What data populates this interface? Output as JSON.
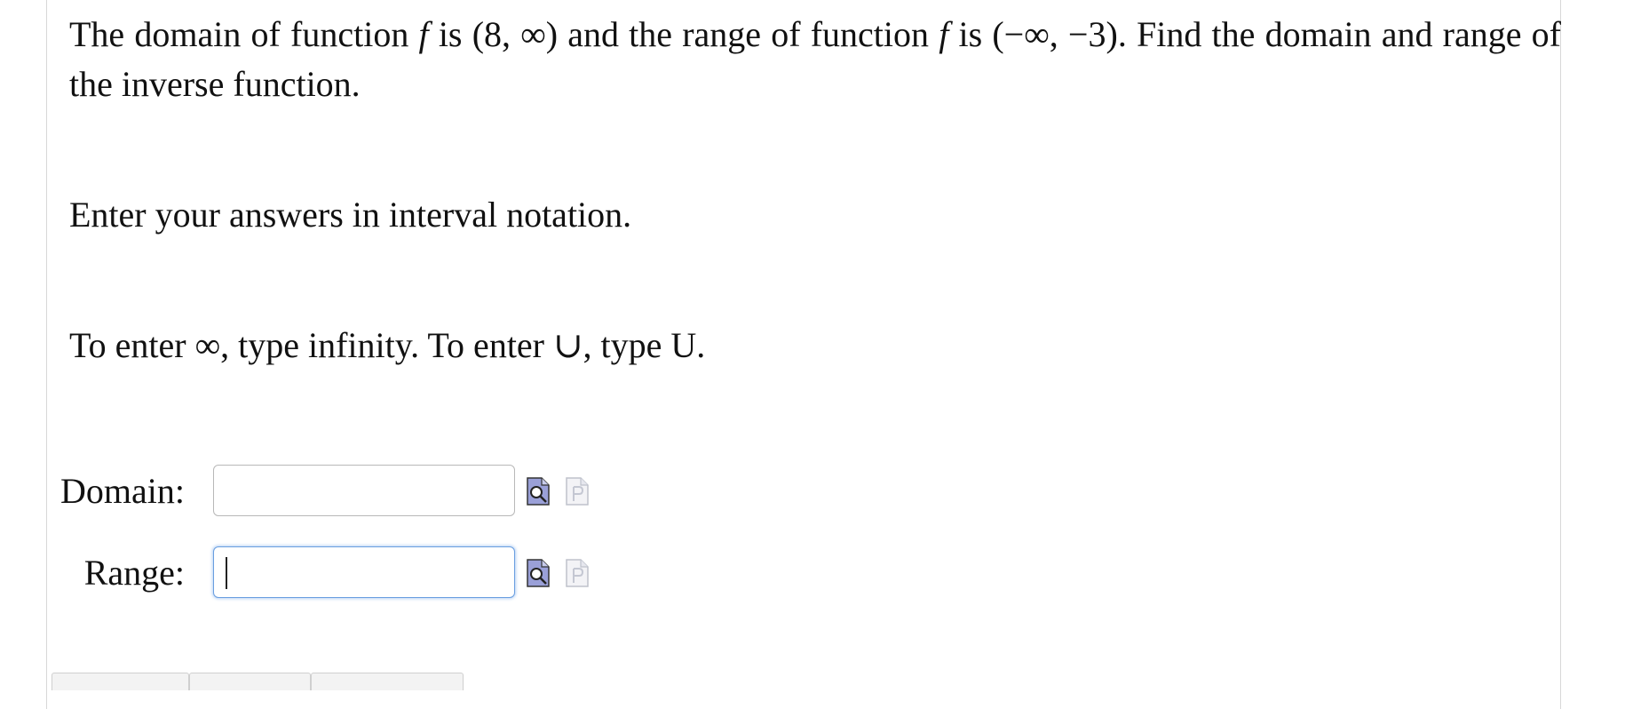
{
  "question": {
    "seg1": "The domain of function ",
    "func_name": "f",
    "seg2": " is ",
    "domain_f": "(8, ∞)",
    "seg3": " and the range of function ",
    "seg4": " is ",
    "range_f": "(−∞, −3)",
    "seg5": ". Find the domain and range of the inverse function."
  },
  "instruction_interval": "Enter your answers in interval notation.",
  "instruction_symbols": "To enter ∞, type infinity. To enter ∪, type U.",
  "answers": [
    {
      "label": "Domain:",
      "value": "",
      "focused": false
    },
    {
      "label": "Range:",
      "value": "",
      "focused": true
    }
  ],
  "icons": {
    "preview": "preview-magnifier-icon",
    "preview_disabled": "preview-disabled-icon"
  },
  "colors": {
    "focus_border": "#6a9fe0",
    "icon_fill": "#9aa0d8"
  }
}
